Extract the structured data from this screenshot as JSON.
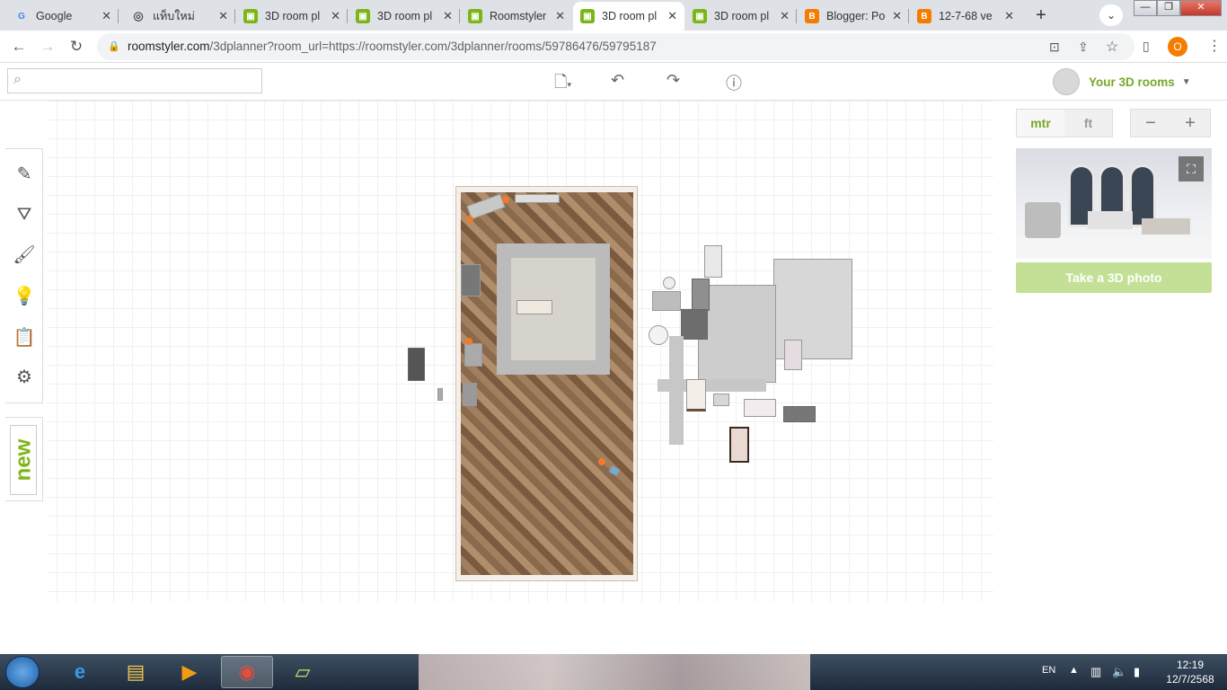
{
  "browser": {
    "tabs": [
      {
        "title": "Google",
        "fav": "G",
        "color": "#ffffff"
      },
      {
        "title": "แท็บใหม่",
        "fav": "◎",
        "color": "#ffffff"
      },
      {
        "title": "3D room pl",
        "fav": "▣",
        "color": "#7cb518"
      },
      {
        "title": "3D room pl",
        "fav": "▣",
        "color": "#7cb518"
      },
      {
        "title": "Roomstyler",
        "fav": "▣",
        "color": "#7cb518"
      },
      {
        "title": "3D room pl",
        "fav": "▣",
        "color": "#7cb518",
        "active": true
      },
      {
        "title": "3D room pl",
        "fav": "▣",
        "color": "#7cb518"
      },
      {
        "title": "Blogger: Po",
        "fav": "B",
        "color": "#f57c00"
      },
      {
        "title": "12-7-68 ve",
        "fav": "B",
        "color": "#f57c00"
      }
    ],
    "new_tab": "+",
    "url_host": "roomstyler.com",
    "url_path": "/3dplanner?room_url=https://roomstyler.com/3dplanner/rooms/59786476/59795187",
    "profile_initial": "O"
  },
  "app": {
    "search_placeholder": "",
    "user_label": "Your 3D rooms",
    "units": {
      "metric": "mtr",
      "imperial": "ft"
    },
    "zoom": {
      "out": "−",
      "in": "+"
    },
    "take_photo": "Take a 3D photo",
    "new_label": "new",
    "accent": "#77a72a"
  },
  "taskbar": {
    "lang": "EN",
    "time": "12:19",
    "date": "12/7/2568"
  }
}
